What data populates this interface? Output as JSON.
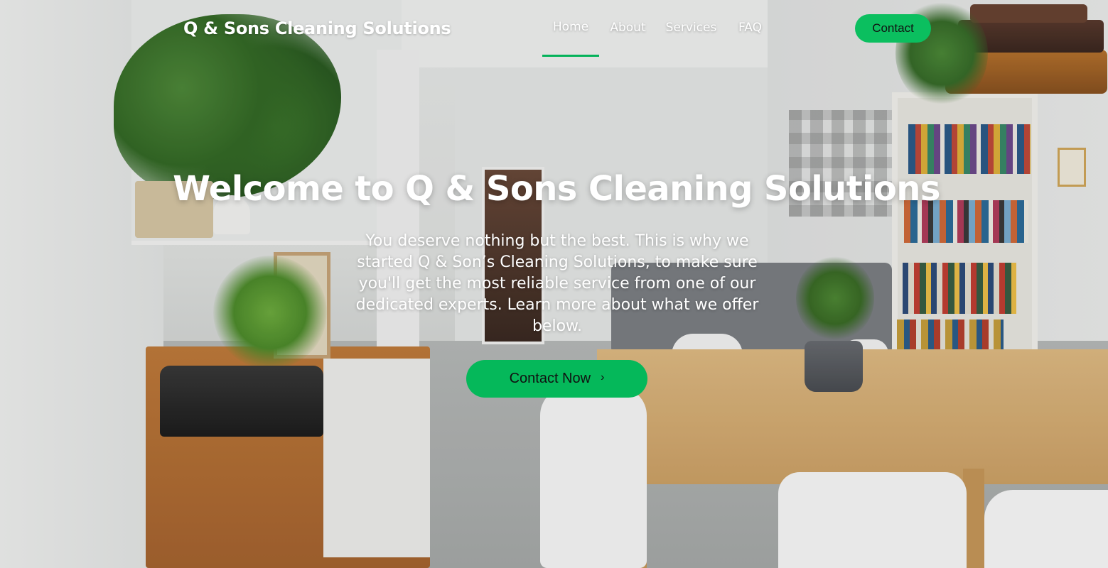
{
  "brand": {
    "name": "Q & Sons Cleaning Solutions"
  },
  "nav": {
    "items": [
      {
        "label": "Home",
        "active": true
      },
      {
        "label": "About",
        "active": false
      },
      {
        "label": "Services",
        "active": false
      },
      {
        "label": "FAQ",
        "active": false
      }
    ],
    "contact_label": "Contact"
  },
  "hero": {
    "title": "Welcome to Q & Sons Cleaning Solutions",
    "text": "You deserve nothing but the best. This is why we started Q & Son’s Cleaning Solutions, to make sure you'll get the most reliable service from one of our dedicated experts. Learn more about what we offer below.",
    "cta_label": "Contact Now",
    "cta_icon": "chevron-right-icon"
  },
  "colors": {
    "accent": "#05b85a",
    "text_on_image": "#ffffff",
    "button_text": "#111111"
  }
}
